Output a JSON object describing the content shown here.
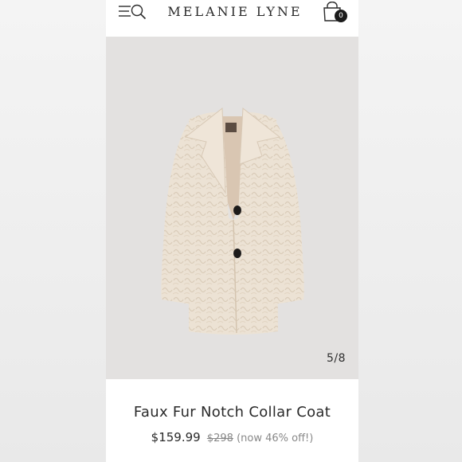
{
  "header": {
    "brand": "MELANIE LYNE",
    "cart_count": "0",
    "icons": [
      "menu-icon",
      "search-icon",
      "shopping-bag-icon"
    ]
  },
  "gallery": {
    "counter": "5/8"
  },
  "product": {
    "title": "Faux Fur Notch Collar Coat",
    "price": "$159.99",
    "original_price": "$298",
    "discount_text": "(now 46% off!)"
  },
  "colors": {
    "coat": "#ece1d2",
    "image_bg": "#e3e1e0",
    "text": "#2a2a2a"
  }
}
